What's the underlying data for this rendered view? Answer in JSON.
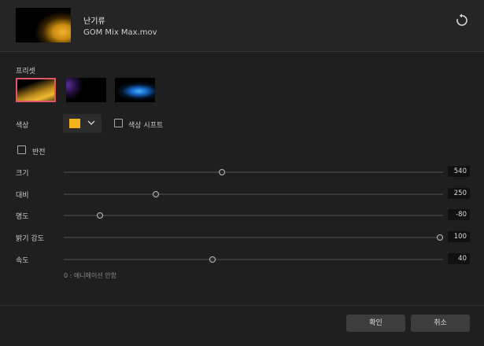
{
  "header": {
    "title": "난기류",
    "filename": "GOM Mix Max.mov",
    "reset_icon": "reset-icon"
  },
  "preset": {
    "label": "프리셋",
    "items": [
      {
        "name": "gold",
        "selected": true
      },
      {
        "name": "purple",
        "selected": false
      },
      {
        "name": "blue",
        "selected": false
      }
    ]
  },
  "color": {
    "label": "색상",
    "swatch": "#f5b31b",
    "shift_label": "색상 시프트",
    "shift_checked": false
  },
  "invert": {
    "label": "반전",
    "checked": false
  },
  "sliders": [
    {
      "label": "크기",
      "value": "540",
      "fraction": 0.425
    },
    {
      "label": "대비",
      "value": "250",
      "fraction": 0.25
    },
    {
      "label": "명도",
      "value": "-80",
      "fraction": 0.104
    },
    {
      "label": "밝기 강도",
      "value": "100",
      "fraction": 1.0
    },
    {
      "label": "속도",
      "value": "40",
      "fraction": 0.4
    }
  ],
  "speed_hint": "0 : 애니메이션 안함",
  "footer": {
    "ok_label": "확인",
    "cancel_label": "취소"
  },
  "colors": {
    "accent_selected": "#e0576a",
    "background": "#1f1f1f"
  }
}
